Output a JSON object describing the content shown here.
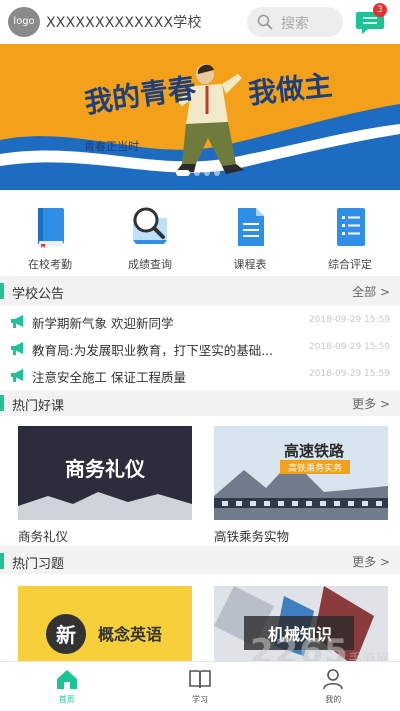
{
  "header": {
    "logo_text": "logo",
    "school_name": "XXXXXXXXXXXXX学校",
    "search_placeholder": "搜索",
    "message_badge": "3"
  },
  "banner": {
    "headline_left": "我的青春",
    "headline_right": "我做主",
    "caption": "青春正当时",
    "slide_count": 4,
    "active_slide": 1
  },
  "quick_menu": [
    {
      "label": "在校考勤",
      "icon": "book-icon"
    },
    {
      "label": "成绩查询",
      "icon": "magnifier-icon"
    },
    {
      "label": "课程表",
      "icon": "document-icon"
    },
    {
      "label": "综合评定",
      "icon": "list-icon"
    }
  ],
  "announcements": {
    "title": "学校公告",
    "more": "全部",
    "items": [
      {
        "title": "新学期新气象 欢迎新同学",
        "time": "2018-09-29 15:59"
      },
      {
        "title": "教育局:为发展职业教育，打下坚实的基础...",
        "time": "2018-09-29 15:59"
      },
      {
        "title": "注意安全施工  保证工程质量",
        "time": "2018-09-29 15:59"
      }
    ]
  },
  "hot_courses": {
    "title": "热门好课",
    "more": "更多",
    "items": [
      {
        "title": "商务礼仪",
        "image_text": "商务礼仪"
      },
      {
        "title": "高铁乘务实物",
        "image_text": "高速铁路",
        "image_subtext": "高铁乘务实务"
      }
    ]
  },
  "hot_exercises": {
    "title": "热门习题",
    "more": "更多",
    "items": [
      {
        "badge": "新",
        "image_text": "概念英语"
      },
      {
        "image_text": "机械知识"
      }
    ]
  },
  "tabbar": [
    {
      "label": "首页",
      "icon": "home-icon",
      "active": true
    },
    {
      "label": "学习",
      "icon": "open-book-icon",
      "active": false
    },
    {
      "label": "我的",
      "icon": "user-icon",
      "active": false
    }
  ],
  "watermark": {
    "text": "2265",
    "sub": "手游网"
  },
  "colors": {
    "accent": "#1bc396",
    "badge": "#e9302f",
    "banner_orange": "#f3a01a",
    "banner_blue": "#1d6cc1"
  }
}
